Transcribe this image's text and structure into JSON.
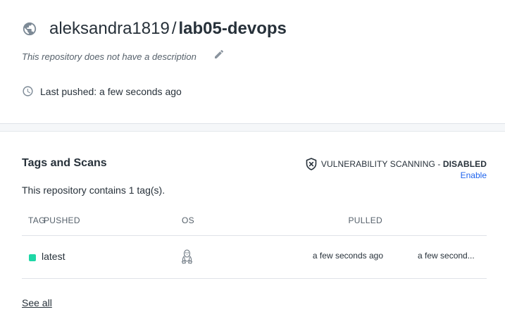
{
  "repo": {
    "owner": "aleksandra1819",
    "separator": "/",
    "name": "lab05-devops",
    "description": "This repository does not have a description",
    "last_pushed": "Last pushed: a few seconds ago"
  },
  "tags_section": {
    "title": "Tags and Scans",
    "vuln_label": "VULNERABILITY SCANNING - ",
    "vuln_status": "DISABLED",
    "enable_link": "Enable",
    "count_text": "This repository contains 1 tag(s).",
    "columns": [
      "TAG",
      "OS",
      "PULLED",
      "PUSHED"
    ],
    "rows": [
      {
        "tag": "latest",
        "os": "linux-icon",
        "pulled": "a few seconds ago",
        "pushed": "a few second..."
      }
    ],
    "see_all": "See all"
  },
  "colors": {
    "accent": "#1d63ed",
    "tag_dot": "#1ed7a6",
    "text": "#27313a",
    "muted": "#56616b"
  }
}
